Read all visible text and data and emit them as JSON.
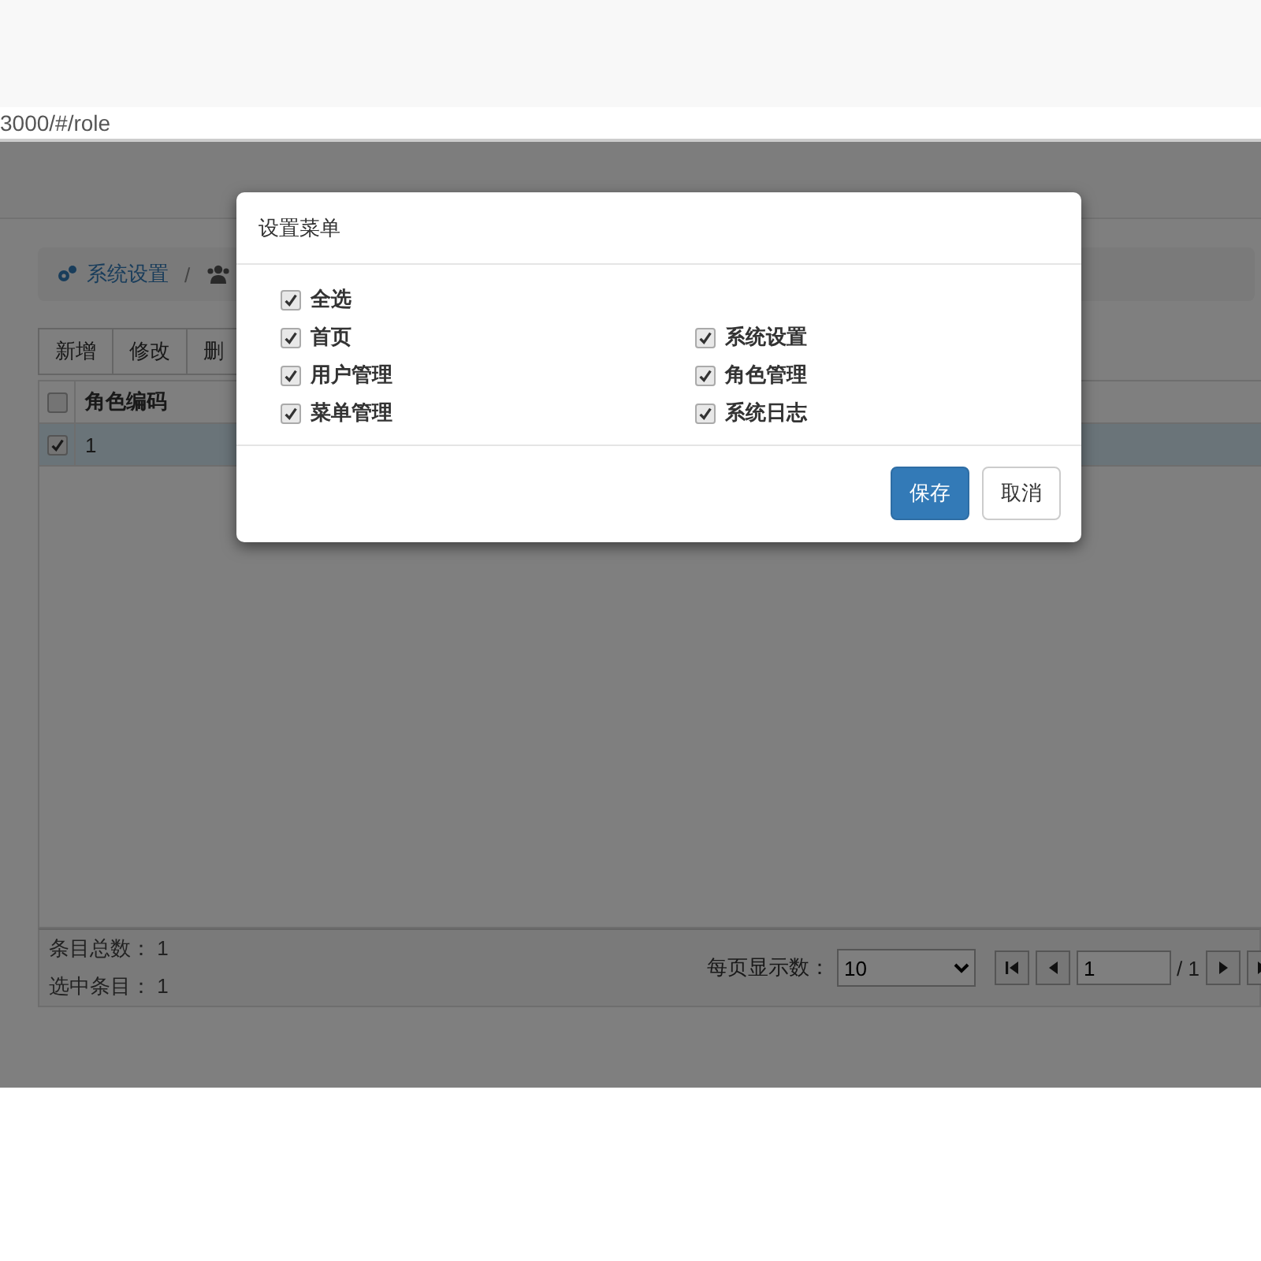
{
  "address_bar": {
    "url": "3000/#/role"
  },
  "breadcrumb": {
    "items": [
      "系统设置"
    ],
    "separator": "/"
  },
  "toolbar": {
    "buttons": [
      "新增",
      "修改",
      "删"
    ]
  },
  "table": {
    "header_checked": false,
    "columns": [
      "角色编码"
    ],
    "rows": [
      {
        "cells": [
          "1"
        ],
        "checked": true,
        "selected": true
      }
    ]
  },
  "footer": {
    "total_label": "条目总数：",
    "total": "1",
    "selected_label": "选中条目：",
    "selected_count": "1",
    "page_size_label": "每页显示数：",
    "page_size": "10",
    "page": "1",
    "page_total": "/ 1"
  },
  "dialog": {
    "title": "设置菜单",
    "select_all": {
      "label": "全选",
      "checked": true
    },
    "items": [
      {
        "label": "首页",
        "checked": true
      },
      {
        "label": "系统设置",
        "checked": true
      },
      {
        "label": "用户管理",
        "checked": true
      },
      {
        "label": "角色管理",
        "checked": true
      },
      {
        "label": "菜单管理",
        "checked": true
      },
      {
        "label": "系统日志",
        "checked": true
      }
    ],
    "buttons": [
      {
        "label": "保存",
        "kind": "primary"
      },
      {
        "label": "取消",
        "kind": "default"
      }
    ]
  }
}
